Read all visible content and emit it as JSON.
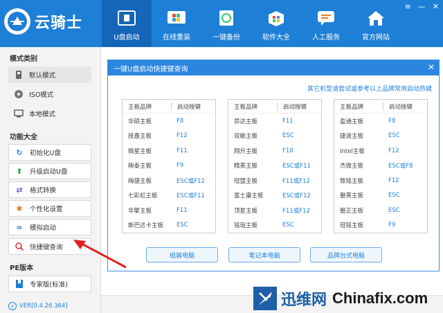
{
  "app": {
    "title": "云骑士",
    "version": "VER[0.4.26.364]"
  },
  "nav_tabs": [
    {
      "label": "U盘启动",
      "icon": "usb-icon",
      "active": true
    },
    {
      "label": "在线重装",
      "icon": "windows-icon",
      "active": false
    },
    {
      "label": "一键备份",
      "icon": "backup-icon",
      "active": false
    },
    {
      "label": "软件大全",
      "icon": "software-box-icon",
      "active": false
    },
    {
      "label": "人工服务",
      "icon": "chat-icon",
      "active": false
    },
    {
      "label": "官方网站",
      "icon": "home-icon",
      "active": false
    }
  ],
  "sidebar": {
    "section1_title": "模式类别",
    "modes": [
      {
        "label": "默认模式",
        "icon": "usb-drive-icon"
      },
      {
        "label": "ISO模式",
        "icon": "disc-icon"
      },
      {
        "label": "本地模式",
        "icon": "monitor-icon"
      }
    ],
    "section2_title": "功能大全",
    "functions": [
      {
        "label": "初始化U盘",
        "icon": "refresh-icon"
      },
      {
        "label": "升级启动U盘",
        "icon": "upload-arrow-icon"
      },
      {
        "label": "格式转换",
        "icon": "convert-icon"
      },
      {
        "label": "个性化设置",
        "icon": "gear-icon"
      },
      {
        "label": "模拟启动",
        "icon": "link-icon"
      },
      {
        "label": "快捷键查询",
        "icon": "search-icon"
      }
    ],
    "section3_title": "PE版本",
    "pe": [
      {
        "label": "专家版(标准)",
        "icon": "bookmark-icon"
      }
    ]
  },
  "dialog": {
    "title": "一键U盘启动快捷键查询",
    "link": "其它机型请尝试或参考以上品牌常用启动热键",
    "col_brand": "主板品牌",
    "col_key": "启动按键",
    "tables": [
      [
        [
          "华硕主板",
          "F8"
        ],
        [
          "技嘉主板",
          "F12"
        ],
        [
          "微星主板",
          "F11"
        ],
        [
          "映泰主板",
          "F9"
        ],
        [
          "梅捷主板",
          "ESC或F12"
        ],
        [
          "七彩虹主板",
          "ESC或F11"
        ],
        [
          "华擎主板",
          "F11"
        ],
        [
          "斯巴达卡主板",
          "ESC"
        ]
      ],
      [
        [
          "昂达主板",
          "F11"
        ],
        [
          "双敏主板",
          "ESC"
        ],
        [
          "翔升主板",
          "F10"
        ],
        [
          "精英主板",
          "ESC或F11"
        ],
        [
          "冠盟主板",
          "F11或F12"
        ],
        [
          "富士康主板",
          "ESC或F12"
        ],
        [
          "顶星主板",
          "F11或F12"
        ],
        [
          "铭瑄主板",
          "ESC"
        ]
      ],
      [
        [
          "盈通主板",
          "F8"
        ],
        [
          "捷波主板",
          "ESC"
        ],
        [
          "Intel主板",
          "F12"
        ],
        [
          "杰微主板",
          "ESC或F8"
        ],
        [
          "致铭主板",
          "F12"
        ],
        [
          "磐英主板",
          "ESC"
        ],
        [
          "磐正主板",
          "ESC"
        ],
        [
          "冠铭主板",
          "F9"
        ]
      ]
    ],
    "buttons": [
      "组装电脑",
      "笔记本电脑",
      "品牌台式电脑"
    ]
  },
  "watermark": {
    "text1": "迅维网",
    "text2": "Chinafix.com"
  },
  "colors": {
    "brand_blue": "#1e7fd6",
    "active_tab": "#1565b8",
    "arrow_red": "#e02020"
  }
}
